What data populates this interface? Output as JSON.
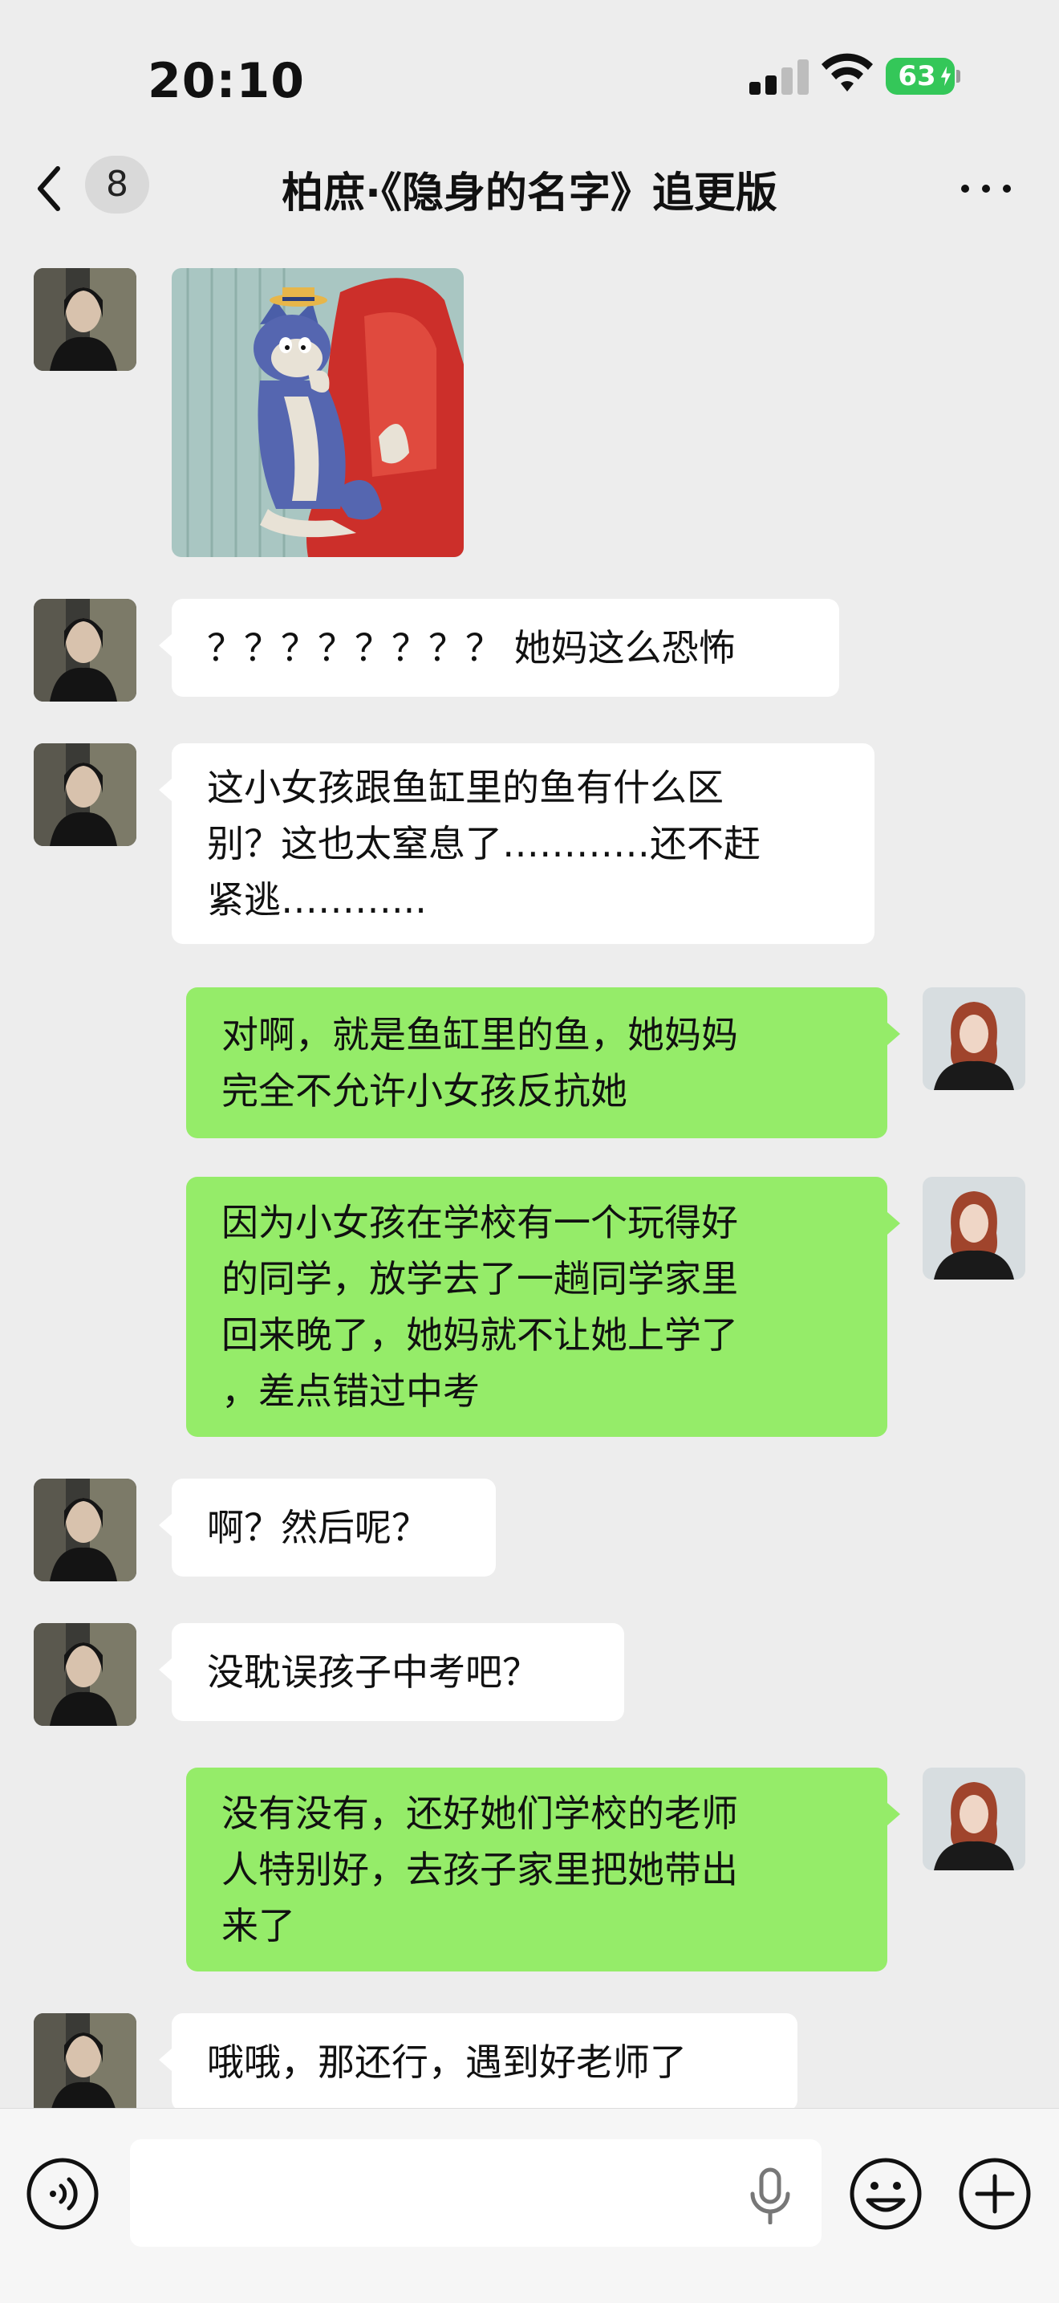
{
  "status_bar": {
    "time": "20:10",
    "battery_level": "63",
    "battery_state": "charging",
    "signal_bars_active": 2,
    "signal_bars_total": 4
  },
  "nav": {
    "unread_count": "8",
    "title": "柏庶·《隐身的名字》追更版",
    "icons": {
      "back": "chevron-left-icon",
      "more": "more-dots-icon"
    }
  },
  "colors": {
    "background": "#ededed",
    "incoming_bubble": "#ffffff",
    "outgoing_bubble": "#95ec69",
    "battery": "#34c759",
    "input_bar": "#f6f6f6"
  },
  "messages": [
    {
      "side": "in",
      "type": "sticker",
      "sticker": "cartoon cat sitting in red armchair"
    },
    {
      "side": "in",
      "type": "text",
      "text": "？？？？？？？？ 她妈这么恐怖"
    },
    {
      "side": "in",
      "type": "text",
      "text": "这小女孩跟鱼缸里的鱼有什么区\n别？这也太窒息了…………还不赶\n紧逃………..."
    },
    {
      "side": "out",
      "type": "text",
      "text": "对啊，就是鱼缸里的鱼，她妈妈\n完全不允许小女孩反抗她"
    },
    {
      "side": "out",
      "type": "text",
      "text": "因为小女孩在学校有一个玩得好\n的同学，放学去了一趟同学家里\n回来晚了，她妈就不让她上学了\n，差点错过中考"
    },
    {
      "side": "in",
      "type": "text",
      "text": "啊？然后呢？"
    },
    {
      "side": "in",
      "type": "text",
      "text": "没耽误孩子中考吧？"
    },
    {
      "side": "out",
      "type": "text",
      "text": "没有没有，还好她们学校的老师\n人特别好，去孩子家里把她带出\n来了"
    },
    {
      "side": "in",
      "type": "text",
      "text": "哦哦，那还行，遇到好老师了"
    }
  ],
  "input_bar": {
    "placeholder": "",
    "value": "",
    "icons": {
      "voice": "voice-mode-icon",
      "mic": "microphone-icon",
      "emoji": "emoji-icon",
      "plus": "plus-icon"
    }
  }
}
